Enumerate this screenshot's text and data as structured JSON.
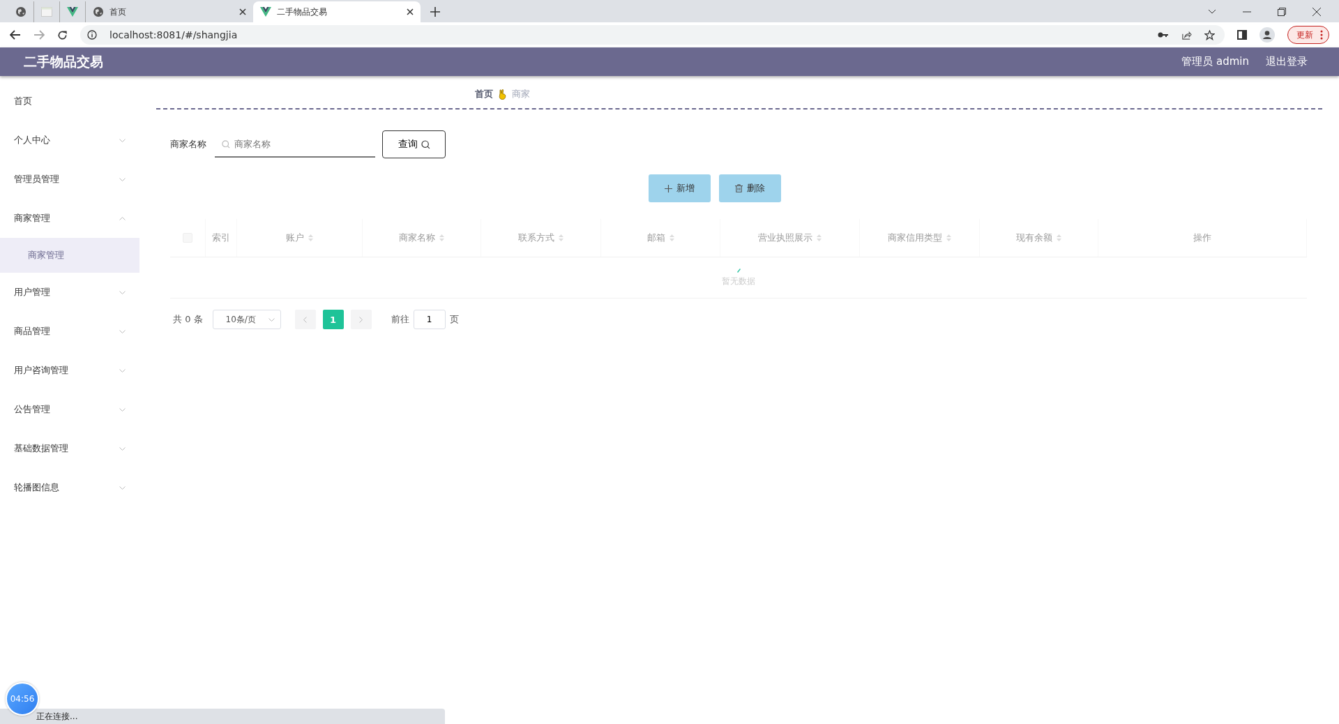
{
  "browser": {
    "tabs": [
      {
        "kind": "globe",
        "selected": false
      },
      {
        "kind": "blank",
        "selected": false
      },
      {
        "kind": "vue",
        "selected": false
      },
      {
        "kind": "globe",
        "title": "首页",
        "selected": false
      },
      {
        "kind": "vue",
        "title": "二手物品交易",
        "selected": true
      }
    ],
    "url": "localhost:8081/#/shangjia",
    "update_button": "更新"
  },
  "header": {
    "title": "二手物品交易",
    "user": "管理员 admin",
    "logout": "退出登录"
  },
  "sidebar": {
    "items": [
      {
        "label": "首页"
      },
      {
        "label": "个人中心",
        "expanded": false
      },
      {
        "label": "管理员管理",
        "expanded": false
      },
      {
        "label": "商家管理",
        "expanded": true,
        "children": [
          {
            "label": "商家管理",
            "selected": true
          }
        ]
      },
      {
        "label": "用户管理",
        "expanded": false
      },
      {
        "label": "商品管理",
        "expanded": false
      },
      {
        "label": "用户咨询管理",
        "expanded": false
      },
      {
        "label": "公告管理",
        "expanded": false
      },
      {
        "label": "基础数据管理",
        "expanded": false
      },
      {
        "label": "轮播图信息",
        "expanded": false
      }
    ]
  },
  "breadcrumb": [
    "首页",
    "商家"
  ],
  "search": {
    "label": "商家名称",
    "placeholder": "商家名称",
    "button": "查询"
  },
  "actions": [
    "新增",
    "删除"
  ],
  "table": {
    "select_all": false,
    "columns": [
      {
        "label": "索引",
        "sortable": false
      },
      {
        "label": "账户",
        "sortable": true
      },
      {
        "label": "商家名称",
        "sortable": true
      },
      {
        "label": "联系方式",
        "sortable": true
      },
      {
        "label": "邮箱",
        "sortable": true
      },
      {
        "label": "营业执照展示",
        "sortable": true
      },
      {
        "label": "商家信用类型",
        "sortable": true
      },
      {
        "label": "现有余额",
        "sortable": true
      },
      {
        "label": "操作",
        "sortable": false
      }
    ],
    "empty_text": "暂无数据"
  },
  "pagination": {
    "total": "共 0 条",
    "page_size": "10条/页",
    "pages": [
      {
        "label": "1",
        "selected": true
      }
    ],
    "goto_label": "前往",
    "goto_value": "1",
    "goto_suffix": "页"
  },
  "timer": "04:56",
  "status_bar": "正在连接..."
}
